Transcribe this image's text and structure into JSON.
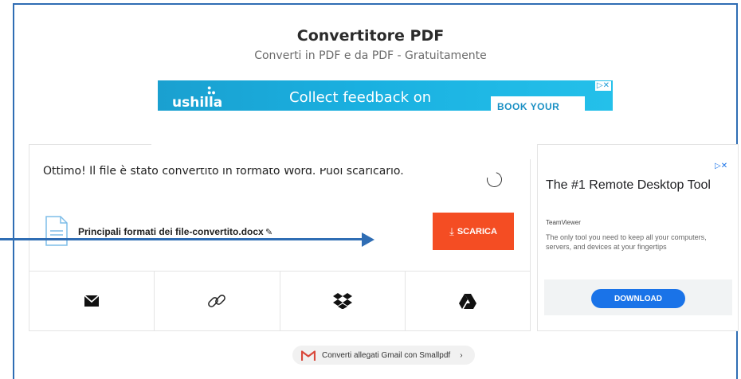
{
  "header": {
    "title": "Convertitore PDF",
    "subtitle": "Converti in PDF e da PDF - Gratuitamente"
  },
  "top_ad": {
    "logo_text": "ushilla",
    "headline": "Collect feedback on",
    "cta": "BOOK YOUR DEMO",
    "ad_marker": "▷✕"
  },
  "result": {
    "message": "Ottimo! Il file è stato convertito in formato Word. Puoi scaricarlo.",
    "file_name": "Principali formati dei file-convertito.docx",
    "download_label": "SCARICA"
  },
  "share_actions": [
    {
      "name": "email",
      "icon": "envelope-icon"
    },
    {
      "name": "link",
      "icon": "link-icon"
    },
    {
      "name": "dropbox",
      "icon": "dropbox-icon"
    },
    {
      "name": "google-drive",
      "icon": "google-drive-icon"
    }
  ],
  "side_ad": {
    "ad_marker": "▷✕",
    "headline": "The #1 Remote Desktop Tool",
    "brand": "TeamViewer",
    "description": "The only tool you need to keep all your computers, servers, and devices at your fingertips",
    "cta": "DOWNLOAD"
  },
  "gmail_promo": {
    "text": "Converti allegati Gmail con Smallpdf",
    "chevron": "›"
  },
  "colors": {
    "accent_frame": "#2f6db4",
    "download_button": "#f44d23",
    "ad_blue": "#1a73e8",
    "banner_blue": "#1ab0e0"
  }
}
